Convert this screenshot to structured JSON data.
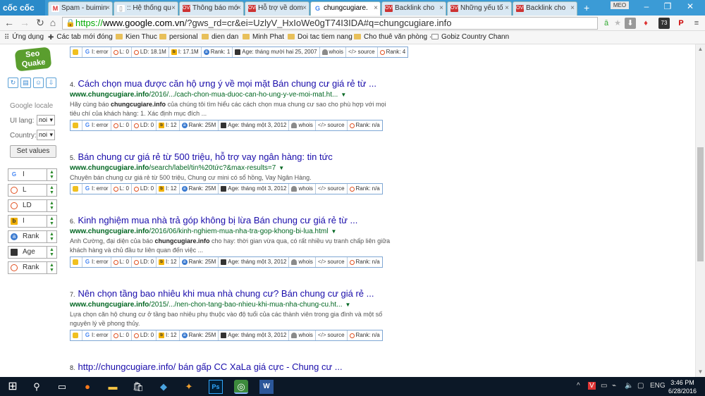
{
  "browser": {
    "brand": "cốc cốc",
    "tabs": [
      {
        "label": "Spam - buimin",
        "icon": "gmail-icon"
      },
      {
        "label": ":: Hệ thống qu",
        "icon": "document-icon"
      },
      {
        "label": "Thông báo mớ",
        "icon": "ove-icon"
      },
      {
        "label": "Hỗ trợ về dom",
        "icon": "ove-icon"
      },
      {
        "label": "chungcugiare.",
        "icon": "google-icon",
        "active": true
      },
      {
        "label": "Backlink cho",
        "icon": "ove-icon"
      },
      {
        "label": "Những yếu tố",
        "icon": "ove-icon"
      },
      {
        "label": "Backlink cho",
        "icon": "ove-icon"
      }
    ],
    "profile_label": "MEO",
    "address": {
      "scheme": "https://",
      "host": "www.google.com.vn",
      "path": "/?gws_rd=cr&ei=UzlyV_HxIoWe0gT74I3IDA#q=chungcugiare.info"
    },
    "ext_badge": "73",
    "bookmarks": [
      "Ứng dụng",
      "Các tab mới đóng",
      "Kien Thuc",
      "persional",
      "dien dan",
      "Minh Phat",
      "Doi tac tiem nang",
      "Cho thuê văn phòng ·",
      "Gobiz Country Chann"
    ]
  },
  "seoquake": {
    "logo": "Seo Quake",
    "locale_label": "Google locale",
    "ui_lang_label": "UI lang:",
    "ui_lang_value": "noi",
    "country_label": "Country:",
    "country_value": "noi",
    "set_values": "Set values",
    "params": [
      {
        "label": "I",
        "icon": "google-icon"
      },
      {
        "label": "L",
        "icon": "ring-icon"
      },
      {
        "label": "LD",
        "icon": "ring-icon"
      },
      {
        "label": "I",
        "icon": "bing-icon"
      },
      {
        "label": "Rank",
        "icon": "rank-icon"
      },
      {
        "label": "Age",
        "icon": "age-icon"
      },
      {
        "label": "Rank",
        "icon": "ring-icon"
      }
    ]
  },
  "results": [
    {
      "bar": [
        "I: error",
        "L: 0",
        "LD: 18.1M",
        "I: 17.1M",
        "Rank: 1",
        "Age: tháng mười hai 25, 2007",
        "whois",
        "source",
        "Rank: 4"
      ]
    },
    {
      "num": "4.",
      "title": "Cách chọn mua được căn hộ ưng ý về mọi mặt Bán chung cư giá rẻ từ ...",
      "url_host": "www.chungcugiare.info",
      "url_path": "/2016/.../cach-chon-mua-duoc-can-ho-ung-y-ve-moi-mat.ht...",
      "snippet_pre": "Hãy cùng báo ",
      "snippet_bold": "chungcugiare.info",
      "snippet_post": " của chúng tôi tìm hiểu các cách chọn mua chung cư sao cho phù hợp với mọi tiêu chí của khách hàng: 1. Xác định mục đích ...",
      "bar": [
        "I: error",
        "L: 0",
        "LD: 0",
        "I: 12",
        "Rank: 25M",
        "Age: tháng một 3, 2012",
        "whois",
        "source",
        "Rank: n/a"
      ]
    },
    {
      "num": "5.",
      "title": "Bán chung cư giá rẻ từ 500 triệu, hỗ trợ vay ngân hàng: tin tức",
      "url_host": "www.chungcugiare.info",
      "url_path": "/search/label/tin%20tức?&max-results=7",
      "snippet_pre": "Chuyên bán chung cư giá rẻ từ 500 triệu, Chung cư mini có sổ hồng, Vay Ngân Hàng.",
      "snippet_bold": "",
      "snippet_post": "",
      "bar": [
        "I: error",
        "L: 0",
        "LD: 0",
        "I: 12",
        "Rank: 25M",
        "Age: tháng một 3, 2012",
        "whois",
        "source",
        "Rank: n/a"
      ]
    },
    {
      "num": "6.",
      "title": "Kinh nghiệm mua nhà trả góp không bị lừa Bán chung cư giá rẻ từ ...",
      "url_host": "www.chungcugiare.info",
      "url_path": "/2016/06/kinh-nghiem-mua-nha-tra-gop-khong-bi-lua.html",
      "snippet_pre": "Anh Cường, đại diện của báo ",
      "snippet_bold": "chungcugiare.info",
      "snippet_post": " cho hay: thời gian vừa qua, có rất nhiều vụ tranh chấp liên giữa khách hàng và chủ đầu tư liên quan đến việc ...",
      "bar": [
        "I: error",
        "L: 0",
        "LD: 0",
        "I: 12",
        "Rank: 25M",
        "Age: tháng một 3, 2012",
        "whois",
        "source",
        "Rank: n/a"
      ]
    },
    {
      "num": "7.",
      "title": "Nên chọn tầng bao nhiêu khi mua nhà chung cư? Bán chung cư giá rẻ ...",
      "url_host": "www.chungcugiare.info",
      "url_path": "/2015/.../nen-chon-tang-bao-nhieu-khi-mua-nha-chung-cu.ht...",
      "snippet_pre": "Lựa chọn căn hộ chung cư ở tầng bao nhiêu phụ thuộc vào độ tuổi của các thành viên trong gia đình và một số nguyên lý về phong thủy.",
      "snippet_bold": "",
      "snippet_post": "",
      "bar": [
        "I: error",
        "L: 0",
        "LD: 0",
        "I: 12",
        "Rank: 25M",
        "Age: tháng một 3, 2012",
        "whois",
        "source",
        "Rank: n/a"
      ]
    },
    {
      "num": "8.",
      "title": "http://chungcugiare.info/ bán gấp CC XaLa giá cực - Chung cư ...",
      "url_host": "",
      "url_path": "",
      "snippet_pre": "",
      "snippet_bold": "",
      "snippet_post": "",
      "bar": []
    }
  ],
  "taskbar": {
    "lang": "ENG",
    "time": "3:46 PM",
    "date": "6/28/2016"
  }
}
